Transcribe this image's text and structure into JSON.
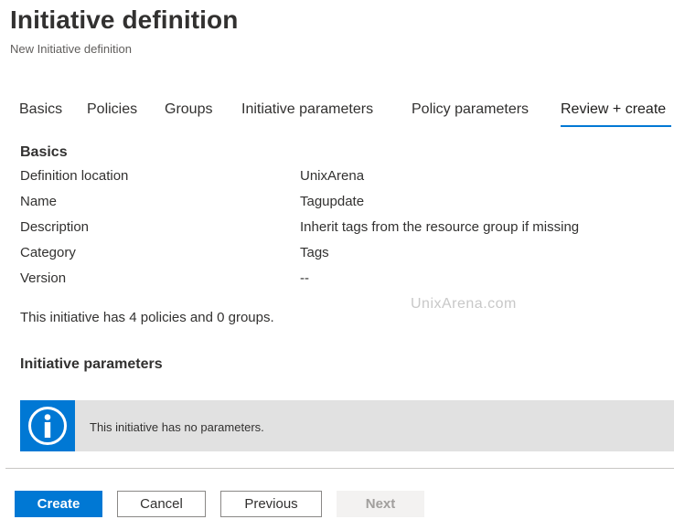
{
  "header": {
    "title": "Initiative definition",
    "subtitle": "New Initiative definition"
  },
  "tabs": [
    {
      "label": "Basics"
    },
    {
      "label": "Policies"
    },
    {
      "label": "Groups"
    },
    {
      "label": "Initiative parameters"
    },
    {
      "label": "Policy parameters"
    },
    {
      "label": "Review + create",
      "active": true
    }
  ],
  "basics": {
    "heading": "Basics",
    "rows": [
      {
        "label": "Definition location",
        "value": "UnixArena"
      },
      {
        "label": "Name",
        "value": "Tagupdate"
      },
      {
        "label": "Description",
        "value": "Inherit tags from the resource group if missing"
      },
      {
        "label": "Category",
        "value": "Tags"
      },
      {
        "label": "Version",
        "value": "--"
      }
    ]
  },
  "watermark": "UnixArena.com",
  "summary": "This initiative has 4 policies and 0 groups.",
  "initiative_parameters": {
    "heading": "Initiative parameters",
    "info_icon": "info-icon",
    "info_text": "This initiative has no parameters."
  },
  "footer": {
    "create_label": "Create",
    "cancel_label": "Cancel",
    "previous_label": "Previous",
    "next_label": "Next"
  },
  "colors": {
    "accent": "#0078d4",
    "info_background": "#e1e1e1",
    "disabled_button": "#f3f2f1"
  }
}
